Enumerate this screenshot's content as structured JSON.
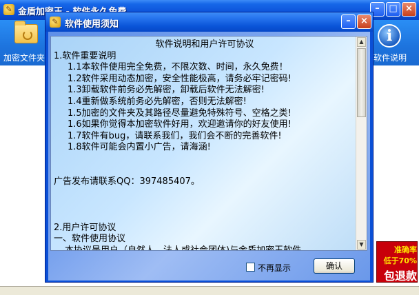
{
  "main_window": {
    "title": "金盾加密王 - 软件永久免费",
    "toolbar": {
      "left_tool_label": "加密文件夹",
      "right_tool_label": "软件说明"
    },
    "ad": {
      "line1": "准确率",
      "line2": "低于70%",
      "line3": "包退款"
    }
  },
  "dialog": {
    "title": "软件使用须知",
    "content": {
      "heading": "软件说明和用户许可协议",
      "section1_title": "1.软件重要说明",
      "items": [
        "1.1本软件使用完全免费，不限次数、时间，永久免费！",
        "1.2软件采用动态加密，安全性能极高，请务必牢记密码!",
        "1.3卸载软件前务必先解密，卸载后软件无法解密!",
        "1.4重新做系统前务必先解密，否则无法解密!",
        "1.5加密的文件夹及其路径尽量避免特殊符号、空格之类!",
        "1.6如果你觉得本加密软件好用，欢迎邀请你的好友使用!",
        "1.7软件有bug，请联系我们，我们会不断的完善软件!",
        "1.8软件可能会内置小广告，请海涵!"
      ],
      "ad_qq": "广告发布请联系QQ：397485407。",
      "section2_title": "2.用户许可协议",
      "section2_sub": "一、软件使用协议",
      "section2_text": "本协议是用户（自然人、法人或社会团体)与金盾加密王软件"
    },
    "dont_show_label": "不再显示",
    "ok_label": "确认"
  }
}
